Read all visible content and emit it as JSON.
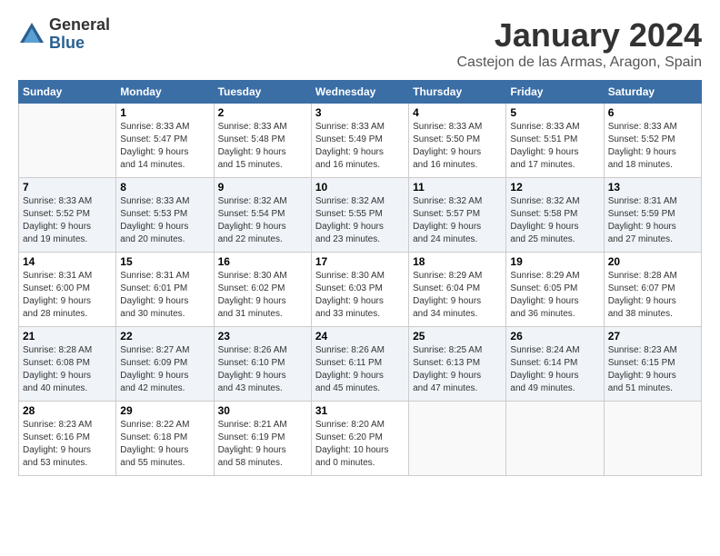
{
  "logo": {
    "general": "General",
    "blue": "Blue"
  },
  "header": {
    "month": "January 2024",
    "location": "Castejon de las Armas, Aragon, Spain"
  },
  "weekdays": [
    "Sunday",
    "Monday",
    "Tuesday",
    "Wednesday",
    "Thursday",
    "Friday",
    "Saturday"
  ],
  "weeks": [
    [
      {
        "day": "",
        "info": ""
      },
      {
        "day": "1",
        "info": "Sunrise: 8:33 AM\nSunset: 5:47 PM\nDaylight: 9 hours\nand 14 minutes."
      },
      {
        "day": "2",
        "info": "Sunrise: 8:33 AM\nSunset: 5:48 PM\nDaylight: 9 hours\nand 15 minutes."
      },
      {
        "day": "3",
        "info": "Sunrise: 8:33 AM\nSunset: 5:49 PM\nDaylight: 9 hours\nand 16 minutes."
      },
      {
        "day": "4",
        "info": "Sunrise: 8:33 AM\nSunset: 5:50 PM\nDaylight: 9 hours\nand 16 minutes."
      },
      {
        "day": "5",
        "info": "Sunrise: 8:33 AM\nSunset: 5:51 PM\nDaylight: 9 hours\nand 17 minutes."
      },
      {
        "day": "6",
        "info": "Sunrise: 8:33 AM\nSunset: 5:52 PM\nDaylight: 9 hours\nand 18 minutes."
      }
    ],
    [
      {
        "day": "7",
        "info": "Sunrise: 8:33 AM\nSunset: 5:52 PM\nDaylight: 9 hours\nand 19 minutes."
      },
      {
        "day": "8",
        "info": "Sunrise: 8:33 AM\nSunset: 5:53 PM\nDaylight: 9 hours\nand 20 minutes."
      },
      {
        "day": "9",
        "info": "Sunrise: 8:32 AM\nSunset: 5:54 PM\nDaylight: 9 hours\nand 22 minutes."
      },
      {
        "day": "10",
        "info": "Sunrise: 8:32 AM\nSunset: 5:55 PM\nDaylight: 9 hours\nand 23 minutes."
      },
      {
        "day": "11",
        "info": "Sunrise: 8:32 AM\nSunset: 5:57 PM\nDaylight: 9 hours\nand 24 minutes."
      },
      {
        "day": "12",
        "info": "Sunrise: 8:32 AM\nSunset: 5:58 PM\nDaylight: 9 hours\nand 25 minutes."
      },
      {
        "day": "13",
        "info": "Sunrise: 8:31 AM\nSunset: 5:59 PM\nDaylight: 9 hours\nand 27 minutes."
      }
    ],
    [
      {
        "day": "14",
        "info": "Sunrise: 8:31 AM\nSunset: 6:00 PM\nDaylight: 9 hours\nand 28 minutes."
      },
      {
        "day": "15",
        "info": "Sunrise: 8:31 AM\nSunset: 6:01 PM\nDaylight: 9 hours\nand 30 minutes."
      },
      {
        "day": "16",
        "info": "Sunrise: 8:30 AM\nSunset: 6:02 PM\nDaylight: 9 hours\nand 31 minutes."
      },
      {
        "day": "17",
        "info": "Sunrise: 8:30 AM\nSunset: 6:03 PM\nDaylight: 9 hours\nand 33 minutes."
      },
      {
        "day": "18",
        "info": "Sunrise: 8:29 AM\nSunset: 6:04 PM\nDaylight: 9 hours\nand 34 minutes."
      },
      {
        "day": "19",
        "info": "Sunrise: 8:29 AM\nSunset: 6:05 PM\nDaylight: 9 hours\nand 36 minutes."
      },
      {
        "day": "20",
        "info": "Sunrise: 8:28 AM\nSunset: 6:07 PM\nDaylight: 9 hours\nand 38 minutes."
      }
    ],
    [
      {
        "day": "21",
        "info": "Sunrise: 8:28 AM\nSunset: 6:08 PM\nDaylight: 9 hours\nand 40 minutes."
      },
      {
        "day": "22",
        "info": "Sunrise: 8:27 AM\nSunset: 6:09 PM\nDaylight: 9 hours\nand 42 minutes."
      },
      {
        "day": "23",
        "info": "Sunrise: 8:26 AM\nSunset: 6:10 PM\nDaylight: 9 hours\nand 43 minutes."
      },
      {
        "day": "24",
        "info": "Sunrise: 8:26 AM\nSunset: 6:11 PM\nDaylight: 9 hours\nand 45 minutes."
      },
      {
        "day": "25",
        "info": "Sunrise: 8:25 AM\nSunset: 6:13 PM\nDaylight: 9 hours\nand 47 minutes."
      },
      {
        "day": "26",
        "info": "Sunrise: 8:24 AM\nSunset: 6:14 PM\nDaylight: 9 hours\nand 49 minutes."
      },
      {
        "day": "27",
        "info": "Sunrise: 8:23 AM\nSunset: 6:15 PM\nDaylight: 9 hours\nand 51 minutes."
      }
    ],
    [
      {
        "day": "28",
        "info": "Sunrise: 8:23 AM\nSunset: 6:16 PM\nDaylight: 9 hours\nand 53 minutes."
      },
      {
        "day": "29",
        "info": "Sunrise: 8:22 AM\nSunset: 6:18 PM\nDaylight: 9 hours\nand 55 minutes."
      },
      {
        "day": "30",
        "info": "Sunrise: 8:21 AM\nSunset: 6:19 PM\nDaylight: 9 hours\nand 58 minutes."
      },
      {
        "day": "31",
        "info": "Sunrise: 8:20 AM\nSunset: 6:20 PM\nDaylight: 10 hours\nand 0 minutes."
      },
      {
        "day": "",
        "info": ""
      },
      {
        "day": "",
        "info": ""
      },
      {
        "day": "",
        "info": ""
      }
    ]
  ]
}
